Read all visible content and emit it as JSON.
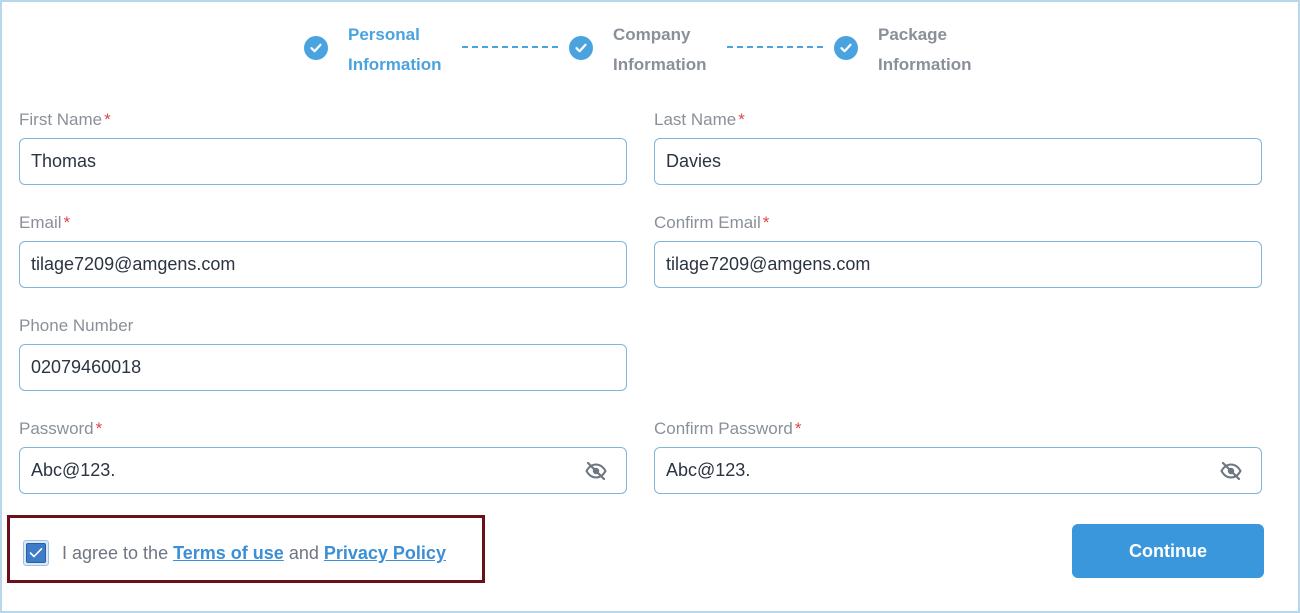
{
  "stepper": {
    "steps": [
      {
        "line1": "Personal",
        "line2": "Information",
        "state": "active"
      },
      {
        "line1": "Company",
        "line2": "Information",
        "state": "inactive"
      },
      {
        "line1": "Package",
        "line2": "Information",
        "state": "inactive"
      }
    ]
  },
  "form": {
    "required_mark": "*",
    "first_name": {
      "label": "First Name",
      "value": "Thomas"
    },
    "last_name": {
      "label": "Last Name",
      "value": "Davies"
    },
    "email": {
      "label": "Email",
      "value": "tilage7209@amgens.com"
    },
    "confirm_email": {
      "label": "Confirm Email",
      "value": "tilage7209@amgens.com"
    },
    "phone": {
      "label": "Phone Number",
      "value": "02079460018"
    },
    "password": {
      "label": "Password",
      "value": "Abc@123."
    },
    "confirm_password": {
      "label": "Confirm Password",
      "value": "Abc@123."
    }
  },
  "agreement": {
    "checked": true,
    "prefix": "I agree to the",
    "terms_link": "Terms of use",
    "conjunction": "and",
    "privacy_link": "Privacy Policy"
  },
  "actions": {
    "continue_label": "Continue"
  },
  "colors": {
    "accent": "#3a97dc",
    "step_active": "#4aa3df",
    "required": "#e04545",
    "highlight_border": "#6b0f1a"
  }
}
